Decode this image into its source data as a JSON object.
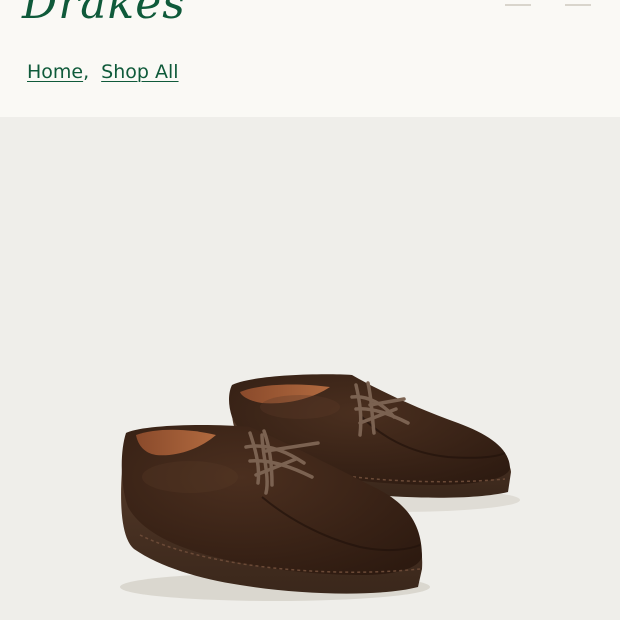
{
  "header": {
    "logo_text": "Drakes",
    "logo_color": "#0f5a3a",
    "background_color": "#faf9f5"
  },
  "breadcrumb": {
    "items": [
      {
        "label": "Home"
      },
      {
        "label": "Shop All"
      }
    ],
    "separator": ","
  },
  "product": {
    "image_icon": "suede-derby-shoes-image",
    "image_background_color": "#efeeea",
    "shoe_color": "#3b2417",
    "sole_color": "#4a3124"
  }
}
